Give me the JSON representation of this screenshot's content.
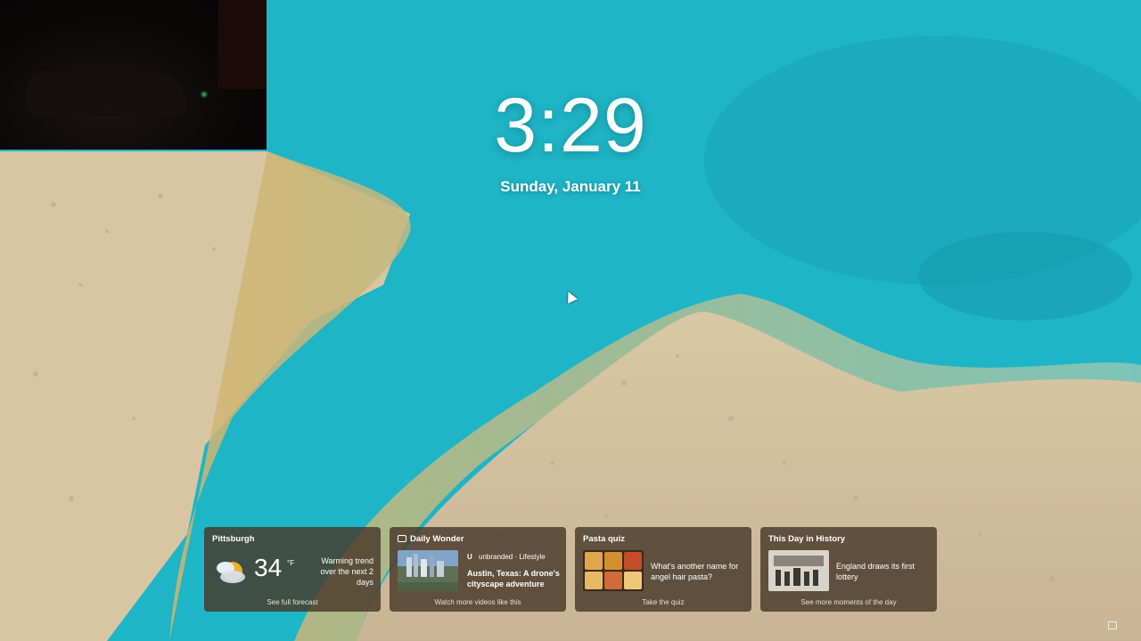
{
  "clock": {
    "time": "3:29",
    "date": "Sunday, January 11"
  },
  "widgets": [
    {
      "type": "weather",
      "title": "Pittsburgh",
      "temperature": "34",
      "unit": "°F",
      "summary": "Warming trend over the next 2 days",
      "footer": "See full forecast",
      "icon": "partly-cloudy-icon"
    },
    {
      "type": "video",
      "title": "Daily Wonder",
      "source": "unbranded · Lifestyle",
      "source_logo": "U",
      "headline": "Austin, Texas: A drone's cityscape adventure",
      "footer": "Watch more videos like this"
    },
    {
      "type": "quiz",
      "title": "Pasta quiz",
      "question": "What's another name for angel hair pasta?",
      "footer": "Take the quiz"
    },
    {
      "type": "history",
      "title": "This Day in History",
      "headline": "England draws its first lottery",
      "footer": "See more moments of the day"
    }
  ],
  "colors": {
    "water": "#1fb9c9",
    "sand": "#d5b98f",
    "card_bg": "#483828"
  }
}
